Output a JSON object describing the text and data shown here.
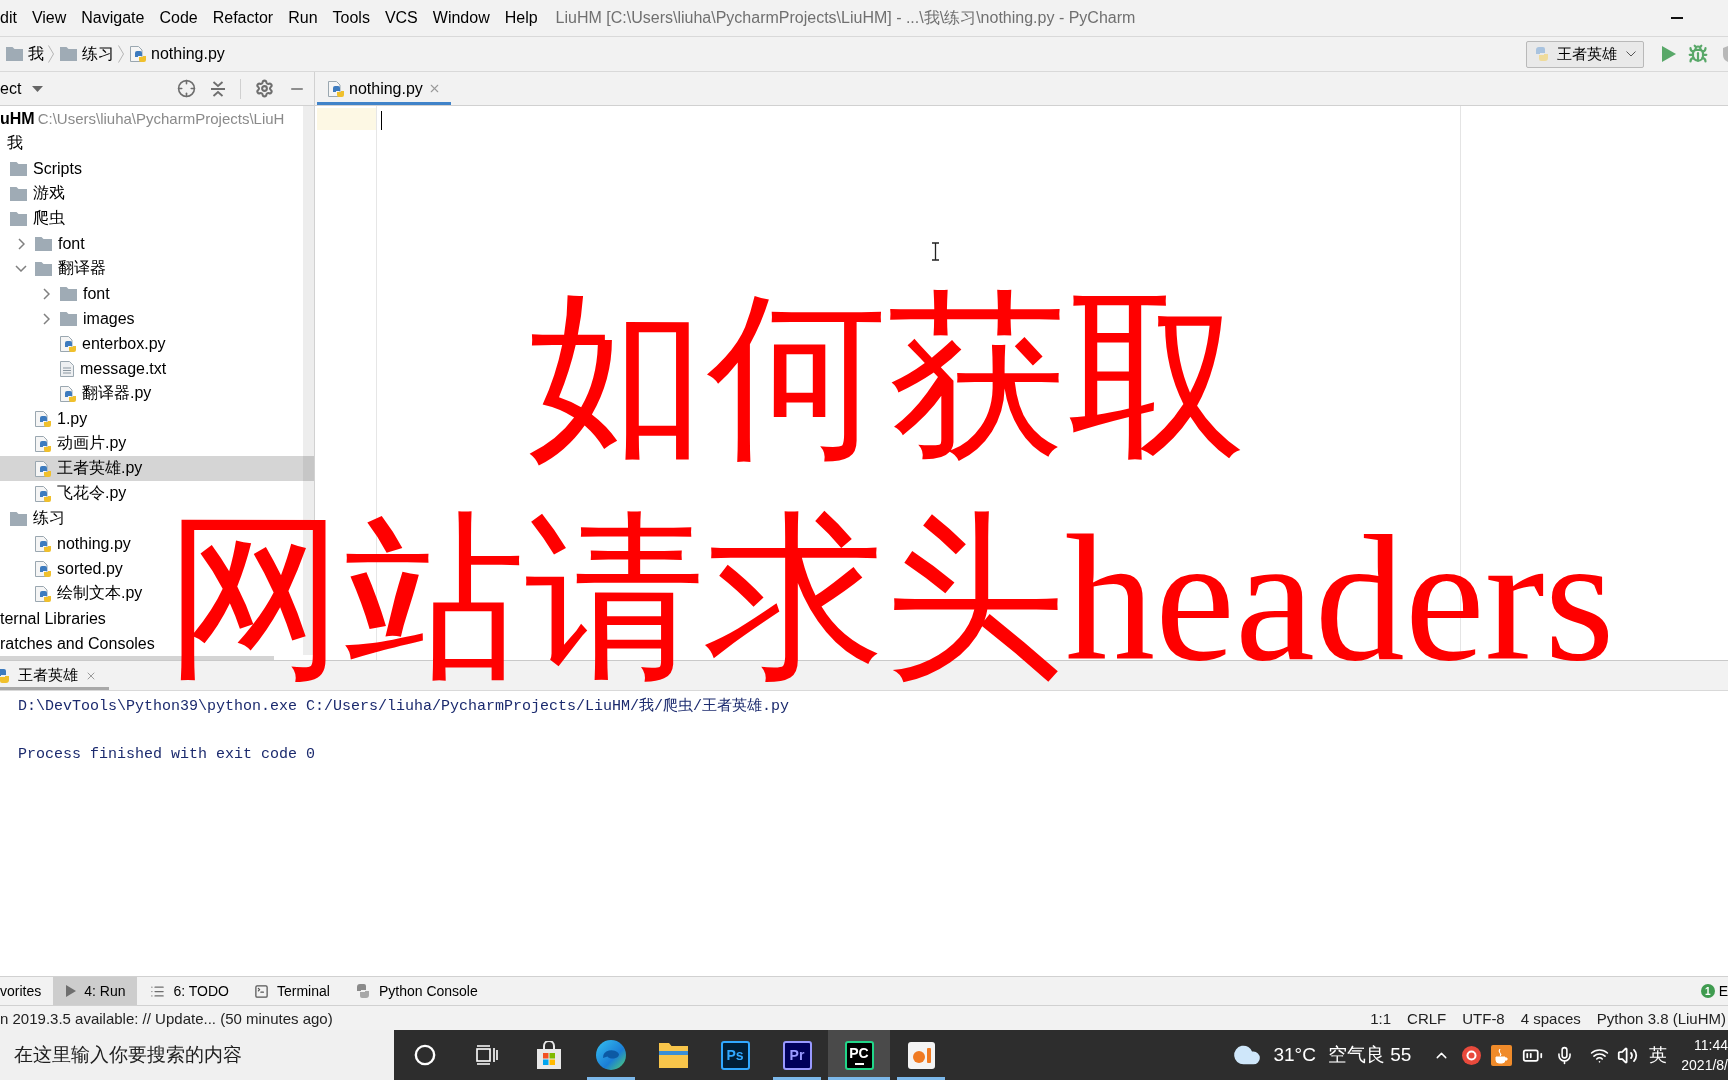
{
  "menu_bar": {
    "items": [
      "dit",
      "View",
      "Navigate",
      "Code",
      "Refactor",
      "Run",
      "Tools",
      "VCS",
      "Window",
      "Help"
    ],
    "title": "LiuHM [C:\\Users\\liuha\\PycharmProjects\\LiuHM] - ...\\我\\练习\\nothing.py - PyCharm"
  },
  "nav_bar": {
    "breadcrumbs": [
      {
        "label": "我",
        "kind": "folder"
      },
      {
        "label": "练习",
        "kind": "folder"
      },
      {
        "label": "nothing.py",
        "kind": "python"
      }
    ],
    "run_config": "王者英雄"
  },
  "project_panel": {
    "title": "ect",
    "tree": [
      {
        "label": "uHM",
        "kind": "project",
        "path": "C:\\Users\\liuha\\PycharmProjects\\LiuH",
        "selected": false,
        "children": [
          {
            "label": "我",
            "selected": false,
            "children": [
              {
                "label": "Scripts",
                "kind": "folder",
                "selected": false
              },
              {
                "label": "游戏",
                "kind": "folder",
                "selected": false
              },
              {
                "label": "爬虫",
                "kind": "folder",
                "selected": false,
                "children": [
                  {
                    "label": "font",
                    "kind": "folder",
                    "expanded": false,
                    "selected": false
                  },
                  {
                    "label": "翻译器",
                    "kind": "folder",
                    "expanded": true,
                    "selected": false,
                    "children": [
                      {
                        "label": "font",
                        "kind": "folder",
                        "expanded": false,
                        "selected": false
                      },
                      {
                        "label": "images",
                        "kind": "folder",
                        "expanded": false,
                        "selected": false
                      },
                      {
                        "label": "enterbox.py",
                        "kind": "python",
                        "selected": false
                      },
                      {
                        "label": "message.txt",
                        "kind": "text",
                        "selected": false
                      },
                      {
                        "label": "翻译器.py",
                        "kind": "python",
                        "selected": false
                      }
                    ]
                  },
                  {
                    "label": "1.py",
                    "kind": "python",
                    "selected": false
                  },
                  {
                    "label": "动画片.py",
                    "kind": "python",
                    "selected": false
                  },
                  {
                    "label": "王者英雄.py",
                    "kind": "python",
                    "selected": true
                  },
                  {
                    "label": "飞花令.py",
                    "kind": "python",
                    "selected": false
                  }
                ]
              },
              {
                "label": "练习",
                "kind": "folder",
                "selected": false,
                "children": [
                  {
                    "label": "nothing.py",
                    "kind": "python",
                    "selected": false
                  },
                  {
                    "label": "sorted.py",
                    "kind": "python",
                    "selected": false
                  },
                  {
                    "label": "绘制文本.py",
                    "kind": "python",
                    "selected": false
                  }
                ]
              }
            ]
          }
        ]
      },
      {
        "label": "ternal Libraries",
        "selected": false
      },
      {
        "label": "ratches and Consoles",
        "selected": false
      }
    ]
  },
  "editor": {
    "tabs": [
      {
        "label": "nothing.py",
        "kind": "python",
        "selected": true
      }
    ]
  },
  "overlay_title": {
    "lines": [
      "如何获取",
      "网站请求头headers"
    ]
  },
  "run_panel": {
    "tabs": [
      {
        "label": "王者英雄",
        "selected": true
      }
    ],
    "output": [
      "D:\\DevTools\\Python39\\python.exe C:/Users/liuha/PycharmProjects/LiuHM/我/爬虫/王者英雄.py",
      "Process finished with exit code 0"
    ]
  },
  "tool_strip": {
    "tabs": [
      {
        "label": "vorites",
        "selected": false
      },
      {
        "label": "4: Run",
        "kind": "run",
        "selected": true
      },
      {
        "label": "6: TODO",
        "kind": "todo",
        "selected": false
      },
      {
        "label": "Terminal",
        "kind": "terminal",
        "selected": false
      },
      {
        "label": "Python Console",
        "kind": "python",
        "selected": false
      }
    ],
    "event_log": {
      "badge": "1",
      "label": "E"
    }
  },
  "status_bar": {
    "message": "n 2019.3.5 available: // Update... (50 minutes ago)",
    "items": [
      "1:1",
      "CRLF",
      "UTF-8",
      "4 spaces",
      "Python 3.8 (LiuHM)"
    ]
  },
  "taskbar": {
    "search_placeholder": "在这里输入你要搜索的内容",
    "apps": [
      {
        "kind": "store",
        "running": false,
        "selected": false
      },
      {
        "kind": "browser",
        "running": true,
        "selected": false
      },
      {
        "kind": "files",
        "running": false,
        "selected": false
      },
      {
        "kind": "ps",
        "label": "Ps",
        "running": false,
        "selected": false
      },
      {
        "kind": "pr",
        "label": "Pr",
        "running": true,
        "selected": false
      },
      {
        "kind": "ide",
        "label": "PC",
        "running": true,
        "selected": true
      },
      {
        "kind": "recorder",
        "running": true,
        "selected": false
      }
    ],
    "weather": {
      "temperature": "31°C",
      "air_quality": "空气良 55"
    },
    "input_method": "英",
    "time": "11:44",
    "date": "2021/8/"
  }
}
